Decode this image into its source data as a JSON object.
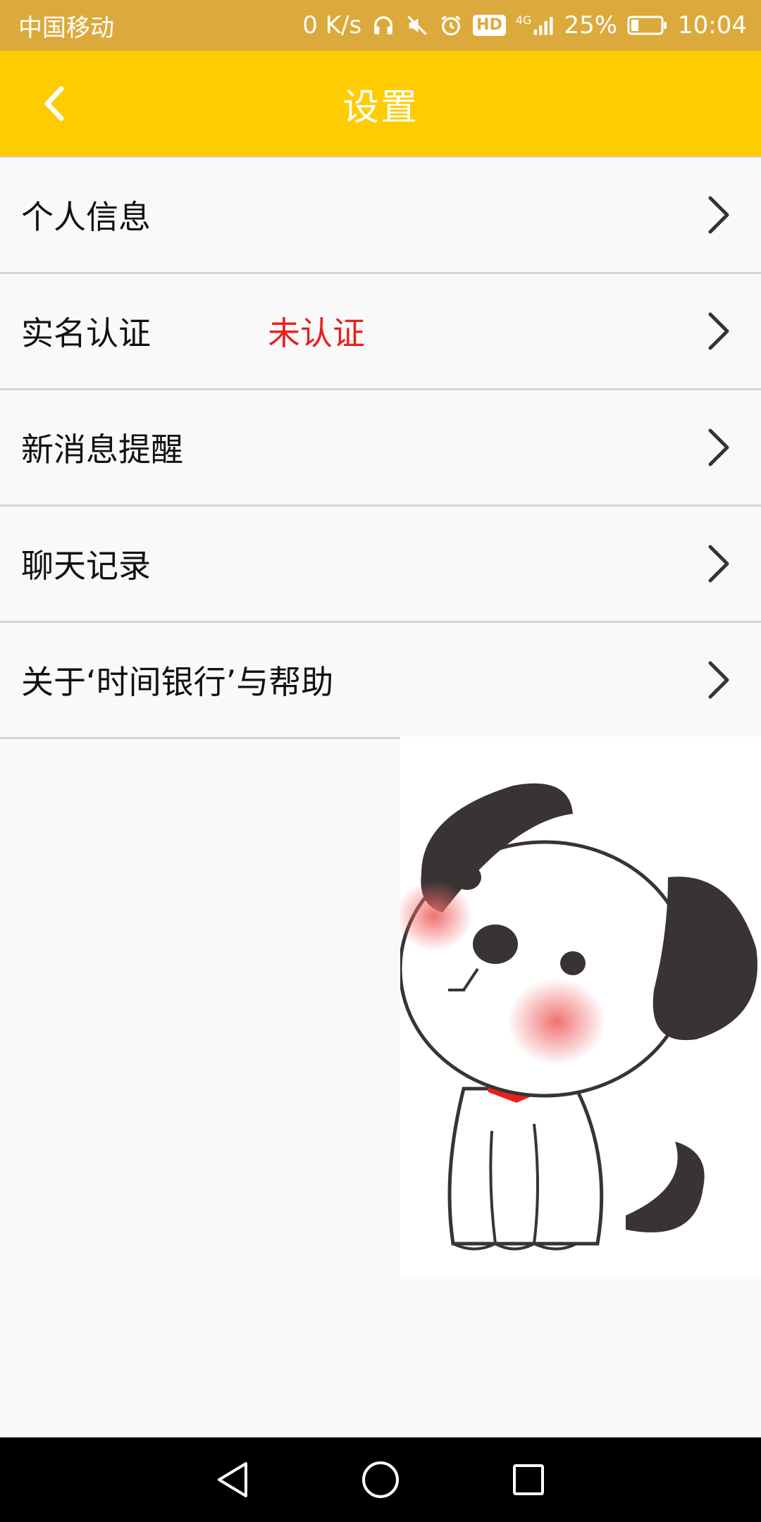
{
  "status_bar": {
    "carrier": "中国移动",
    "net_speed": "0 K/s",
    "hd_label": "HD",
    "network_type": "4G",
    "battery_percent": "25%",
    "battery_level": 0.25,
    "time": "10:04"
  },
  "header": {
    "title": "设置",
    "back_icon": "chevron-left-icon"
  },
  "menu": {
    "items": [
      {
        "label": "个人信息",
        "status": ""
      },
      {
        "label": "实名认证",
        "status": "未认证"
      },
      {
        "label": "新消息提醒",
        "status": ""
      },
      {
        "label": "聊天记录",
        "status": ""
      },
      {
        "label": "关于‘时间银行’与帮助",
        "status": ""
      }
    ],
    "chevron_icon": "chevron-right-icon"
  },
  "colors": {
    "status_bar_bg": "#dcaa3c",
    "header_bg": "#fecc00",
    "status_alert": "#e8201b",
    "divider": "#d6d6d6"
  },
  "nav_bar": {
    "icons": [
      "back-triangle-icon",
      "home-circle-icon",
      "recents-square-icon"
    ]
  }
}
